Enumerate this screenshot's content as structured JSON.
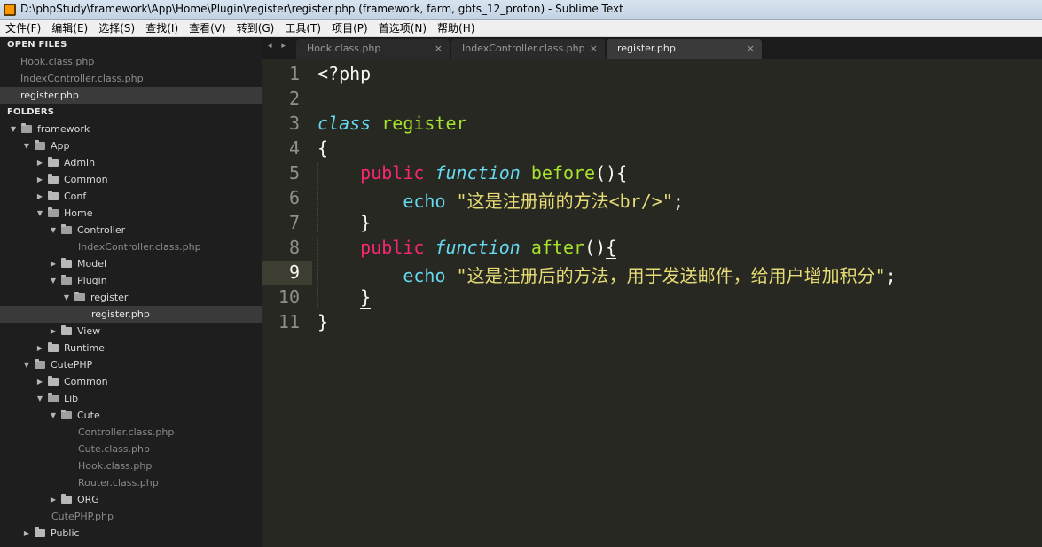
{
  "window": {
    "title": "D:\\phpStudy\\framework\\App\\Home\\Plugin\\register\\register.php (framework, farm, gbts_12_proton) - Sublime Text"
  },
  "menu": [
    "文件(F)",
    "编辑(E)",
    "选择(S)",
    "查找(I)",
    "查看(V)",
    "转到(G)",
    "工具(T)",
    "项目(P)",
    "首选项(N)",
    "帮助(H)"
  ],
  "sidebar": {
    "open_files_header": "OPEN FILES",
    "open_files": [
      "Hook.class.php",
      "IndexController.class.php",
      "register.php"
    ],
    "folders_header": "FOLDERS",
    "tree": [
      {
        "label": "framework",
        "type": "folder",
        "expanded": true
      },
      {
        "label": "App",
        "type": "folder",
        "expanded": true
      },
      {
        "label": "Admin",
        "type": "folder",
        "expanded": false
      },
      {
        "label": "Common",
        "type": "folder",
        "expanded": false
      },
      {
        "label": "Conf",
        "type": "folder",
        "expanded": false
      },
      {
        "label": "Home",
        "type": "folder",
        "expanded": true
      },
      {
        "label": "Controller",
        "type": "folder",
        "expanded": true
      },
      {
        "label": "IndexController.class.php",
        "type": "file"
      },
      {
        "label": "Model",
        "type": "folder",
        "expanded": false
      },
      {
        "label": "Plugin",
        "type": "folder",
        "expanded": true
      },
      {
        "label": "register",
        "type": "folder",
        "expanded": true
      },
      {
        "label": "register.php",
        "type": "file",
        "selected": true
      },
      {
        "label": "View",
        "type": "folder",
        "expanded": false
      },
      {
        "label": "Runtime",
        "type": "folder",
        "expanded": false
      },
      {
        "label": "CutePHP",
        "type": "folder",
        "expanded": true
      },
      {
        "label": "Common",
        "type": "folder",
        "expanded": false
      },
      {
        "label": "Lib",
        "type": "folder",
        "expanded": true
      },
      {
        "label": "Cute",
        "type": "folder",
        "expanded": true
      },
      {
        "label": "Controller.class.php",
        "type": "file"
      },
      {
        "label": "Cute.class.php",
        "type": "file"
      },
      {
        "label": "Hook.class.php",
        "type": "file"
      },
      {
        "label": "Router.class.php",
        "type": "file"
      },
      {
        "label": "ORG",
        "type": "folder",
        "expanded": false
      },
      {
        "label": "CutePHP.php",
        "type": "file"
      },
      {
        "label": "Public",
        "type": "folder",
        "expanded": false
      }
    ]
  },
  "tabs": [
    {
      "label": "Hook.class.php",
      "active": false
    },
    {
      "label": "IndexController.class.php",
      "active": false
    },
    {
      "label": "register.php",
      "active": true
    }
  ],
  "tab_nav": "◂ ▸",
  "tab_close": "×",
  "editor": {
    "line_numbers": [
      "1",
      "2",
      "3",
      "4",
      "5",
      "6",
      "7",
      "8",
      "9",
      "10",
      "11"
    ],
    "current_line": 9,
    "code": {
      "l1": "<?php",
      "l3_kw": "class",
      "l3_name": "register",
      "l4": "{",
      "l5_pub": "public",
      "l5_fn": "function",
      "l5_name": "before",
      "l5_rest": "(){",
      "l6_echo": "echo",
      "l6_str": "\"这是注册前的方法<br/>\"",
      "l6_end": ";",
      "l7": "}",
      "l8_pub": "public",
      "l8_fn": "function",
      "l8_name": "after",
      "l8_rest_a": "()",
      "l8_rest_b": "{",
      "l9_echo": "echo",
      "l9_str": "\"这是注册后的方法，用于发送邮件，给用户增加积分\"",
      "l9_end": ";",
      "l10": "}",
      "l11": "}"
    }
  },
  "colors": {
    "background": "#272822",
    "keyword": "#f92672",
    "storage": "#66d9ef",
    "class_name": "#a6e22e",
    "string": "#e6db74"
  }
}
